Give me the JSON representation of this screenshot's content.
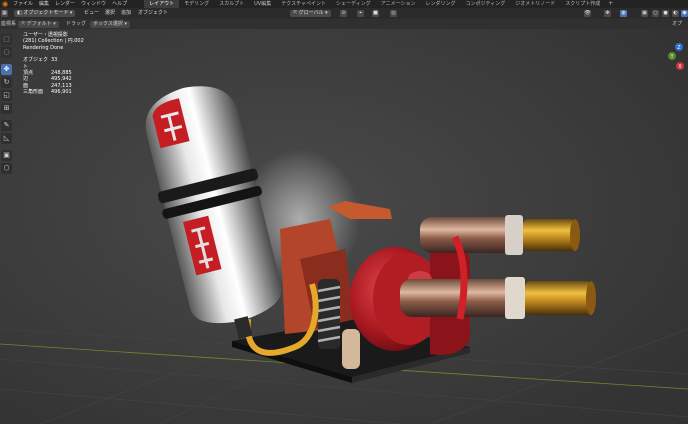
{
  "menu": {
    "items": [
      "ファイル",
      "編集",
      "レンダー",
      "ウィンドウ",
      "ヘルプ"
    ],
    "workspaces": [
      "レイアウト",
      "モデリング",
      "スカルプト",
      "UV編集",
      "テクスチャペイント",
      "シェーディング",
      "アニメーション",
      "レンダリング",
      "コンポジティング",
      "ジオメトリノード",
      "スクリプト作成"
    ],
    "active_workspace": 0,
    "add_tab": "+"
  },
  "header": {
    "mode": "オブジェクトモード",
    "view": "ビュー",
    "select": "選択",
    "add": "追加",
    "object": "オブジェクト",
    "orientation": "グローバル",
    "right_label": "オプ"
  },
  "tool_settings": {
    "transform_label": "座標系",
    "orientation_value": "デフォルト",
    "drag_label": "ドラッグ",
    "drag_value": "ボックス選択"
  },
  "overlay": {
    "view_name": "ユーザー・透視投影",
    "collection": "(281) Collection | 円.002",
    "status": "Rendering Done",
    "stats": [
      {
        "label": "オブジェクト",
        "value": "33"
      },
      {
        "label": "頂点",
        "value": "248,885"
      },
      {
        "label": "辺",
        "value": "495,942"
      },
      {
        "label": "面",
        "value": "247,113"
      },
      {
        "label": "三角形面",
        "value": "496,901"
      }
    ]
  },
  "tools": [
    "select-box",
    "cursor",
    "move",
    "rotate",
    "scale",
    "transform",
    "annotate",
    "measure",
    "add-cube"
  ],
  "gizmo_labels": {
    "z": "Z",
    "y": "Y",
    "x": "X"
  },
  "colors": {
    "accent": "#4772b3",
    "background": "#3d3d3d",
    "body_red": "#c41e24"
  }
}
